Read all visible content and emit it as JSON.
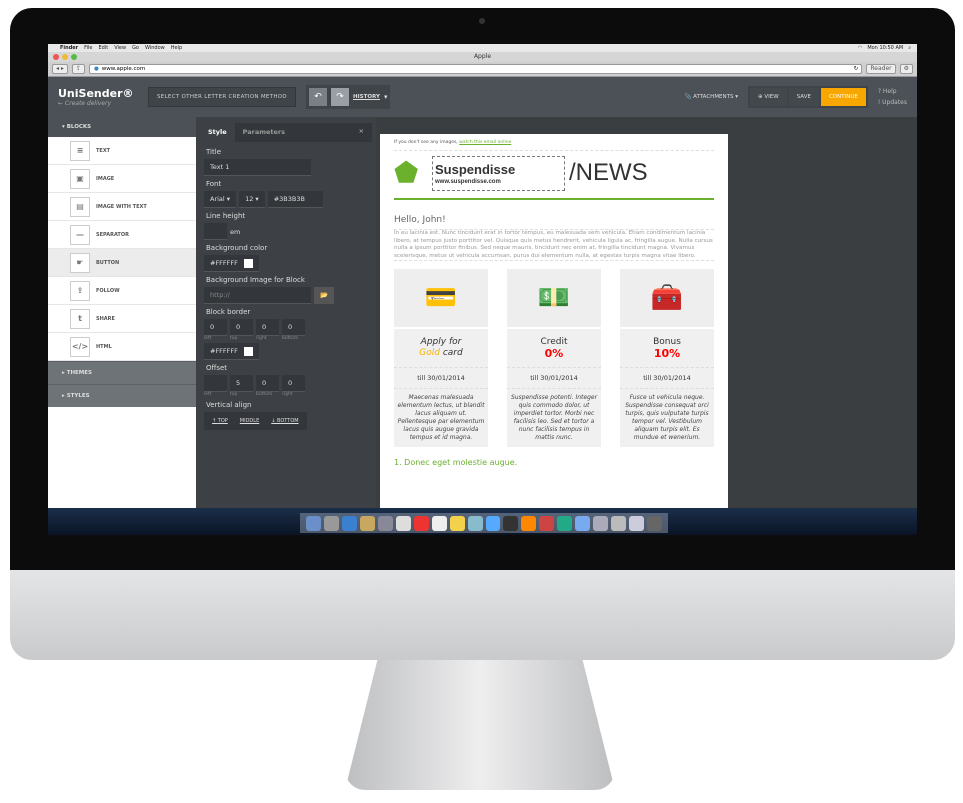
{
  "mac": {
    "menu": [
      "Finder",
      "File",
      "Edit",
      "View",
      "Go",
      "Window",
      "Help"
    ],
    "clock": "Mon 10:50 AM",
    "window_title": "Apple",
    "url": "www.apple.com",
    "reader": "Reader"
  },
  "header": {
    "brand": "UniSender®",
    "back": "← Create delivery",
    "select_method": "SELECT OTHER LETTER CREATION METHOD",
    "history": "HISTORY",
    "attachments": "ATTACHMENTS",
    "view": "VIEW",
    "save": "SAVE",
    "continue": "CONTINUE",
    "help": "Help",
    "updates": "Updates",
    "accent": "#F8A600"
  },
  "sidebar": {
    "blocks": "BLOCKS",
    "items": [
      {
        "label": "TEXT",
        "icon": "≡"
      },
      {
        "label": "IMAGE",
        "icon": "▣"
      },
      {
        "label": "IMAGE WITH TEXT",
        "icon": "▤"
      },
      {
        "label": "SEPARATOR",
        "icon": "—"
      },
      {
        "label": "BUTTON",
        "icon": "☛"
      },
      {
        "label": "FOLLOW",
        "icon": "⇪"
      },
      {
        "label": "SHARE",
        "icon": "t"
      },
      {
        "label": "HTML",
        "icon": "</>"
      }
    ],
    "themes": "THEMES",
    "styles": "STYLES"
  },
  "panel": {
    "tab_style": "Style",
    "tab_params": "Parameters",
    "title_label": "Title",
    "title_value": "Text 1",
    "font_label": "Font",
    "font": "Arial",
    "size": "12",
    "color": "#3B3B3B",
    "line_height_label": "Line height",
    "em": "em",
    "bg_color_label": "Background color",
    "bg_color": "#FFFFFF",
    "bg_image_label": "Background Image for Block",
    "bg_image_placeholder": "http://",
    "border_label": "Block border",
    "border": [
      "0",
      "0",
      "0",
      "0"
    ],
    "border_sides": [
      "left",
      "top",
      "right",
      "bottom"
    ],
    "border_color": "#FFFFFF",
    "offset_label": "Offset",
    "offset": [
      "",
      "5",
      "0",
      "0"
    ],
    "offset_sides": [
      "left",
      "top",
      "bottom",
      "right"
    ],
    "valign_label": "Vertical align",
    "valign": [
      "TOP",
      "MIDDLE",
      "BOTTOM"
    ]
  },
  "email": {
    "pre": "If you don't see any images, ",
    "pre_link": "watch this email online",
    "brand": "Suspendisse",
    "brand_url": "www.suspendisse.com",
    "news": "/NEWS",
    "hello": "Hello, John!",
    "lorem": "In eu lacinia est. Nunc tincidunt erat in tortor tempus, eu malesuada sem vehicula. Etiam condimentum lacinia libero, at tempus justo porttitor vel. Quisque quis metus hendrerit, vehicula ligula ac, fringilla augue. Nulla cursus nulla a ipsum porttitor finibus. Sed neque mauris, tincidunt nec enim at, fringilla tincidunt magna. Vivamus scelerisque, metus ut vehicula accumsan, purus dui elementum nulla, at egestas turpis magna vitae libero.",
    "cards": [
      {
        "icon": "💳",
        "t1": "Apply for",
        "t2a": "Gold",
        "t2b": " card",
        "date": "till 30/01/2014",
        "text": "Maecenas malesuada elementum lectus, ut blandit lacus aliquam ut. Pellentesque par elementum lacus quis augue gravida tempus et id magna."
      },
      {
        "icon": "💵",
        "t1": "Credit",
        "t2a": "0%",
        "date": "till 30/01/2014",
        "text": "Suspendisse potenti. Integer quis commodo dolor, ut imperdiet tortor. Morbi nec facilisis leo. Sed et tortor a nunc facilisis tempus in mattis nunc."
      },
      {
        "icon": "🧰",
        "t1": "Bonus",
        "t2a": "10%",
        "date": "till 30/01/2014",
        "text": "Fusce ut vehicula neque. Suspendisse consequat orci turpis, quis vulputate turpis tempor vel. Vestibulum aliquam turpis elit. Es mundue et wenerium."
      }
    ],
    "list1": "1. Donec eget molestie augue."
  }
}
